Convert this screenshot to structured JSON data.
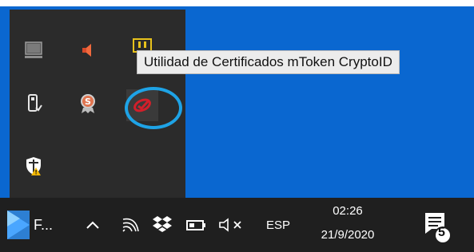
{
  "tooltip": {
    "text": "Utilidad de Certificados mToken CryptoID"
  },
  "tray_flyout": {
    "icons": [
      {
        "name": "network-monitor-icon"
      },
      {
        "name": "speaker-icon"
      },
      {
        "name": "chip-icon"
      },
      {
        "name": "usb-drive-icon"
      },
      {
        "name": "security-badge-icon"
      },
      {
        "name": "mtoken-cryptoid-icon"
      },
      {
        "name": "windows-security-warning-icon"
      }
    ]
  },
  "taskbar": {
    "app_label": "F...",
    "language": "ESP",
    "time": "02:26",
    "date": "21/9/2020",
    "notification_count": "5"
  },
  "colors": {
    "desktop": "#0a67d0",
    "flyout": "#2b2b2b",
    "taskbar": "#1f1f1f",
    "highlight_circle": "#1ea3e6",
    "mtoken_red": "#d21f2a"
  }
}
